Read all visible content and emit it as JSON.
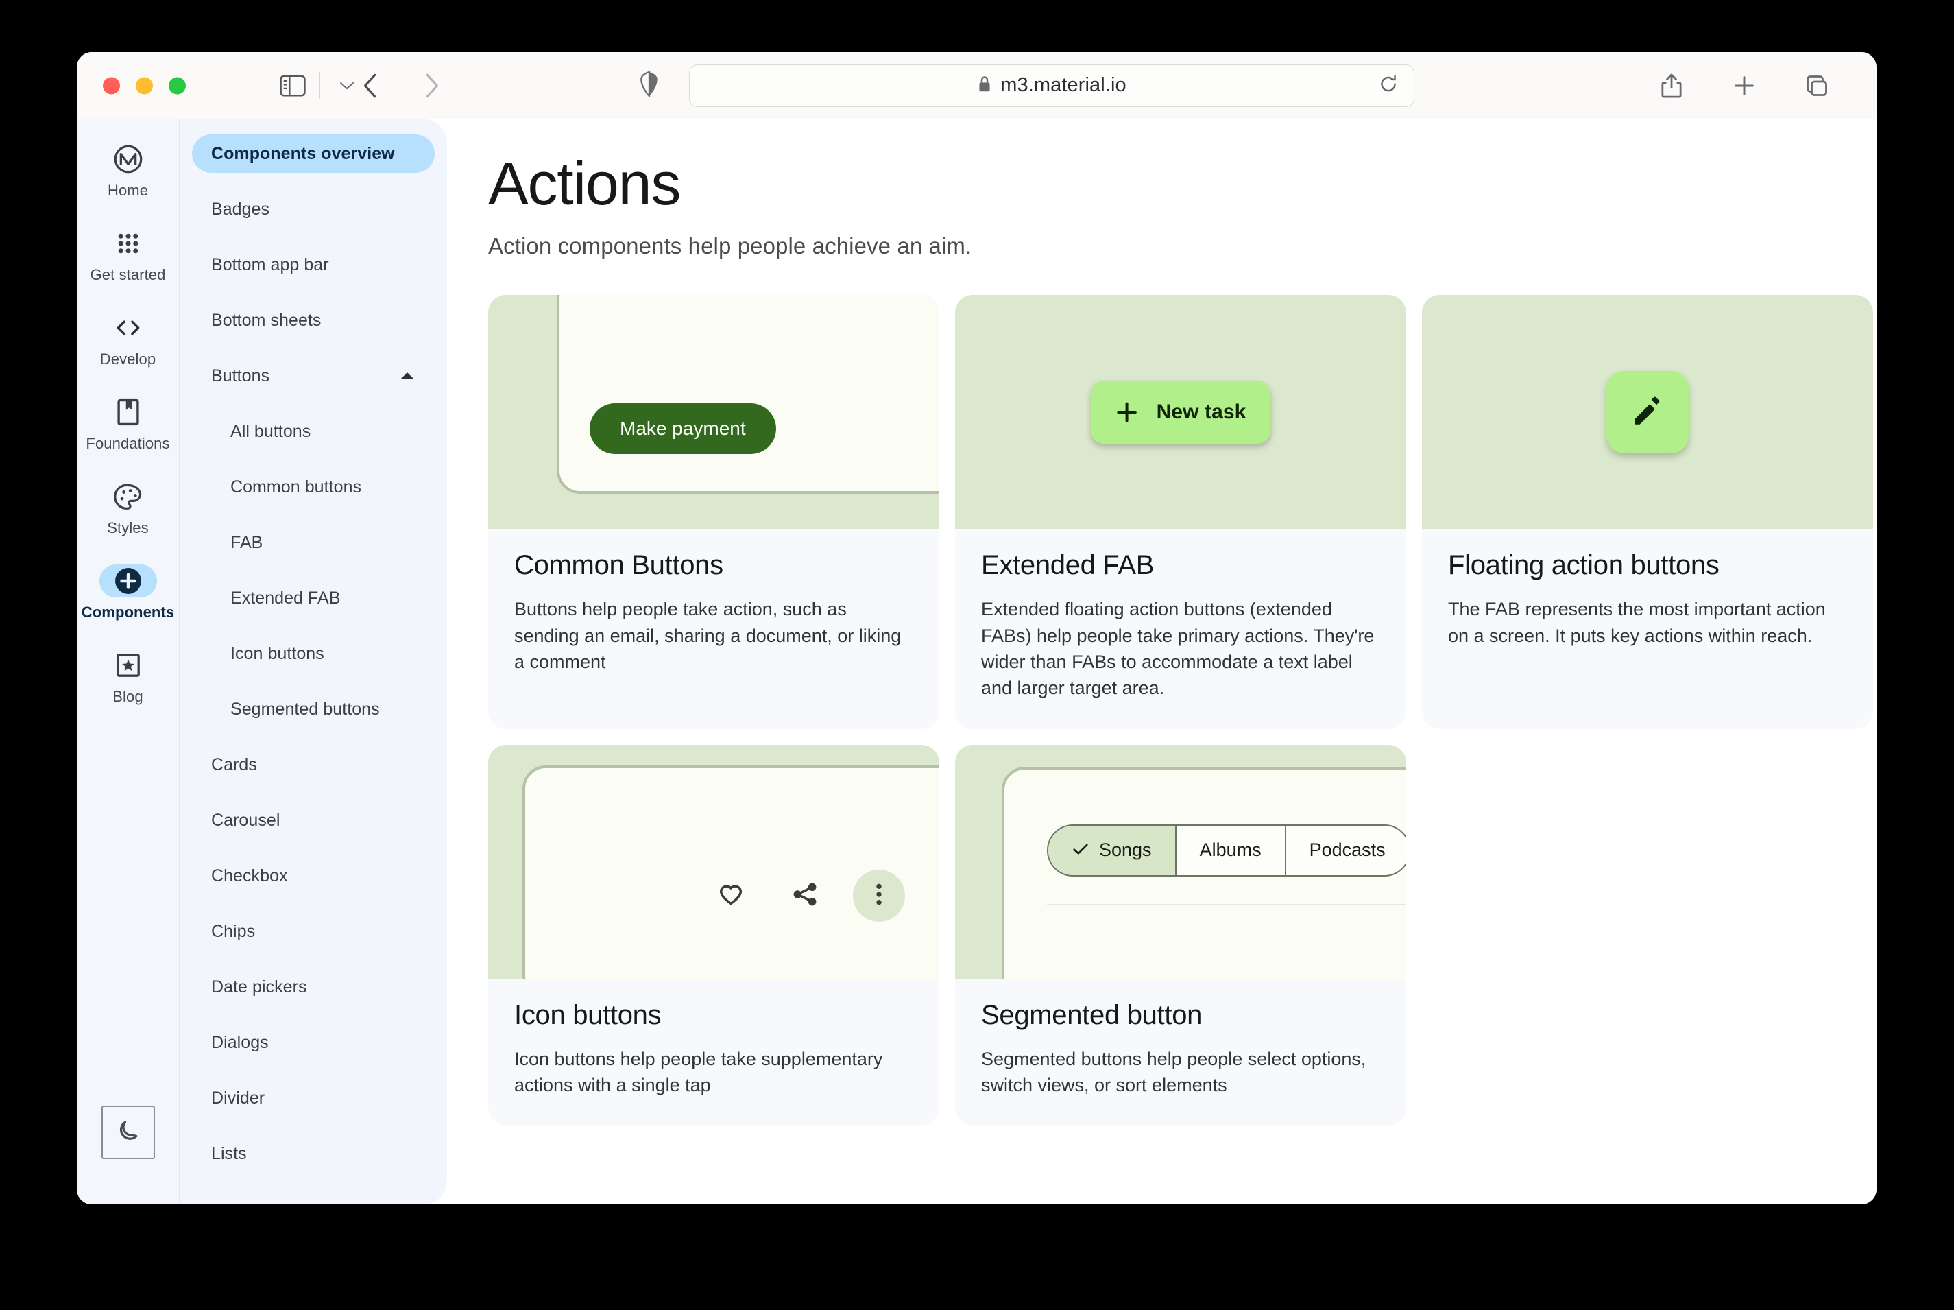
{
  "browser": {
    "url": "m3.material.io",
    "lock_icon": "lock-icon",
    "sidebar_toggle_icon": "sidebar-toggle-icon",
    "sidebar_dropdown_icon": "chevron-down-icon",
    "back_icon": "chevron-left-icon",
    "forward_icon": "chevron-right-icon",
    "privacy_icon": "shield-icon",
    "reload_icon": "reload-icon",
    "share_icon": "share-icon",
    "new_tab_icon": "plus-icon",
    "tab_overview_icon": "tab-overview-icon",
    "traffic_lights": [
      "close",
      "minimize",
      "maximize"
    ]
  },
  "rail": {
    "items": [
      {
        "label": "Home",
        "icon": "material-logo-icon",
        "active": false
      },
      {
        "label": "Get started",
        "icon": "grid-dots-icon",
        "active": false
      },
      {
        "label": "Develop",
        "icon": "code-brackets-icon",
        "active": false
      },
      {
        "label": "Foundations",
        "icon": "bookmark-icon",
        "active": false
      },
      {
        "label": "Styles",
        "icon": "palette-icon",
        "active": false
      },
      {
        "label": "Components",
        "icon": "plus-circle-icon",
        "active": true
      },
      {
        "label": "Blog",
        "icon": "star-square-icon",
        "active": false
      }
    ],
    "theme_toggle_icon": "moon-icon"
  },
  "subnav": {
    "items": [
      {
        "label": "Components overview",
        "active": true,
        "child": false,
        "caret": ""
      },
      {
        "label": "Badges",
        "active": false,
        "child": false,
        "caret": ""
      },
      {
        "label": "Bottom app bar",
        "active": false,
        "child": false,
        "caret": ""
      },
      {
        "label": "Bottom sheets",
        "active": false,
        "child": false,
        "caret": ""
      },
      {
        "label": "Buttons",
        "active": false,
        "child": false,
        "caret": "chevron-up-icon"
      },
      {
        "label": "All buttons",
        "active": false,
        "child": true,
        "caret": ""
      },
      {
        "label": "Common buttons",
        "active": false,
        "child": true,
        "caret": ""
      },
      {
        "label": "FAB",
        "active": false,
        "child": true,
        "caret": ""
      },
      {
        "label": "Extended FAB",
        "active": false,
        "child": true,
        "caret": ""
      },
      {
        "label": "Icon buttons",
        "active": false,
        "child": true,
        "caret": ""
      },
      {
        "label": "Segmented buttons",
        "active": false,
        "child": true,
        "caret": ""
      },
      {
        "label": "Cards",
        "active": false,
        "child": false,
        "caret": ""
      },
      {
        "label": "Carousel",
        "active": false,
        "child": false,
        "caret": ""
      },
      {
        "label": "Checkbox",
        "active": false,
        "child": false,
        "caret": ""
      },
      {
        "label": "Chips",
        "active": false,
        "child": false,
        "caret": ""
      },
      {
        "label": "Date pickers",
        "active": false,
        "child": false,
        "caret": ""
      },
      {
        "label": "Dialogs",
        "active": false,
        "child": false,
        "caret": ""
      },
      {
        "label": "Divider",
        "active": false,
        "child": false,
        "caret": ""
      },
      {
        "label": "Lists",
        "active": false,
        "child": false,
        "caret": ""
      }
    ]
  },
  "main": {
    "title": "Actions",
    "subtitle": "Action components help people achieve an aim.",
    "cards": [
      {
        "title": "Common Buttons",
        "desc": "Buttons help people take action, such as sending an email, sharing a document, or liking a comment",
        "demo": {
          "kind": "filled-button",
          "button_label": "Make payment"
        }
      },
      {
        "title": "Extended FAB",
        "desc": "Extended floating action buttons (extended FABs) help people take primary actions. They're wider than FABs to accommodate a text label and larger target area.",
        "demo": {
          "kind": "extended-fab",
          "button_label": "New task",
          "icon": "plus-icon"
        }
      },
      {
        "title": "Floating action buttons",
        "desc": "The FAB represents the most important action on a screen. It puts key actions within reach.",
        "demo": {
          "kind": "fab",
          "icon": "pencil-icon"
        }
      },
      {
        "title": "Icon buttons",
        "desc": "Icon buttons help people take supplementary actions with a single tap",
        "demo": {
          "kind": "icon-buttons",
          "icons": [
            "heart-icon",
            "share-icon",
            "more-vert-icon"
          ]
        }
      },
      {
        "title": "Segmented button",
        "desc": "Segmented buttons help people select options, switch views, or sort elements",
        "demo": {
          "kind": "segmented",
          "segments": [
            {
              "label": "Songs",
              "selected": true,
              "icon": "check-icon"
            },
            {
              "label": "Albums",
              "selected": false,
              "icon": ""
            },
            {
              "label": "Podcasts",
              "selected": false,
              "icon": ""
            }
          ]
        }
      }
    ]
  },
  "colors": {
    "accent_blue": "#b6e0fe",
    "hero_green": "#dce8cd",
    "fab_green": "#b1ef8b",
    "filled_button_green": "#33691e",
    "surface_cream": "#fbfcf3",
    "card_bg": "#f7f9fd",
    "nav_bg": "#f2f5fb"
  }
}
